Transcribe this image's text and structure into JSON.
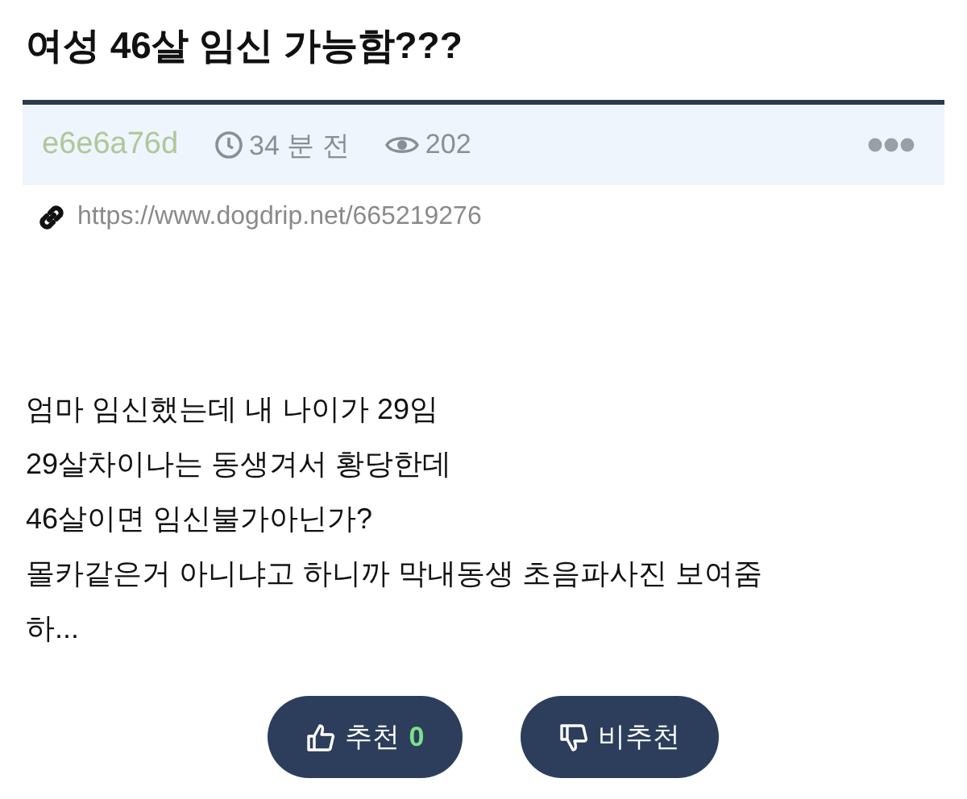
{
  "title": "여성 46살 임신 가능함???",
  "meta": {
    "author": "e6e6a76d",
    "time": "34 분 전",
    "views": "202"
  },
  "link": "https://www.dogdrip.net/665219276",
  "body": [
    "엄마 임신했는데 내 나이가 29임",
    "29살차이나는 동생겨서 황당한데",
    "46살이면 임신불가아닌가?",
    "몰카같은거 아니냐고 하니까 막내동생 초음파사진 보여줌",
    "하..."
  ],
  "votes": [
    {
      "kind": "up",
      "label": "추천",
      "count": "0"
    },
    {
      "kind": "down",
      "label": "비추천"
    }
  ]
}
